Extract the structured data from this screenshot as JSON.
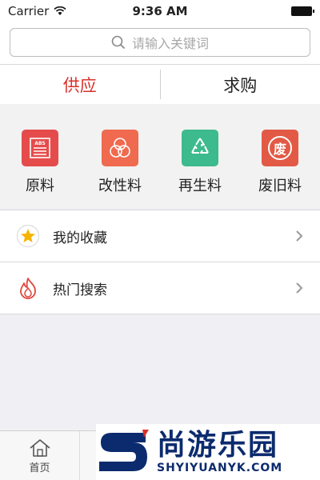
{
  "status_bar": {
    "carrier": "Carrier",
    "time": "9:36 AM"
  },
  "search": {
    "placeholder": "请输入关键词"
  },
  "tabs": [
    {
      "label": "供应",
      "active": true
    },
    {
      "label": "求购",
      "active": false
    }
  ],
  "categories": [
    {
      "label": "原料",
      "icon": "abs-document-icon",
      "color": "#e54b4b",
      "icon_text": "ABS"
    },
    {
      "label": "改性料",
      "icon": "triple-circle-icon",
      "color": "#f06a4f"
    },
    {
      "label": "再生料",
      "icon": "recycle-icon",
      "color": "#3dbb8e"
    },
    {
      "label": "废旧料",
      "icon": "waste-char-icon",
      "color": "#e25a45",
      "icon_text": "废"
    }
  ],
  "list": [
    {
      "label": "我的收藏",
      "icon": "star-icon"
    },
    {
      "label": "热门搜索",
      "icon": "flame-icon"
    }
  ],
  "bottom_tabs": [
    {
      "label": "首页",
      "icon": "home-icon"
    }
  ],
  "watermark": {
    "main": "尚游乐园",
    "sub": "SHYIYUANYK.COM"
  },
  "colors": {
    "accent": "#d8322b",
    "star": "#f5b400",
    "flame": "#e0463a"
  }
}
